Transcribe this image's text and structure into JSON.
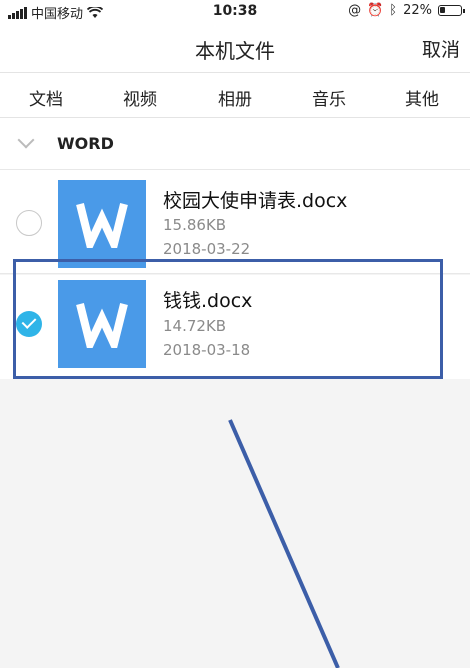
{
  "status_bar": {
    "carrier": "中国移动",
    "time": "10:38",
    "battery": "22%"
  },
  "header": {
    "title": "本机文件",
    "cancel": "取消"
  },
  "tabs": [
    {
      "label": "文档",
      "active": true
    },
    {
      "label": "视频"
    },
    {
      "label": "相册"
    },
    {
      "label": "音乐"
    },
    {
      "label": "其他"
    }
  ],
  "section": {
    "label": "WORD"
  },
  "files": [
    {
      "name": "校园大使申请表.docx",
      "size": "15.86KB",
      "date": "2018-03-22",
      "selected": false
    },
    {
      "name": "钱钱.docx",
      "size": "14.72KB",
      "date": "2018-03-18",
      "selected": true
    }
  ],
  "colors": {
    "accent": "#2fb4e8",
    "file_icon": "#4a9ae8",
    "annotation": "#3c5ea8"
  },
  "icons": {
    "file_type": "word-document-icon"
  }
}
